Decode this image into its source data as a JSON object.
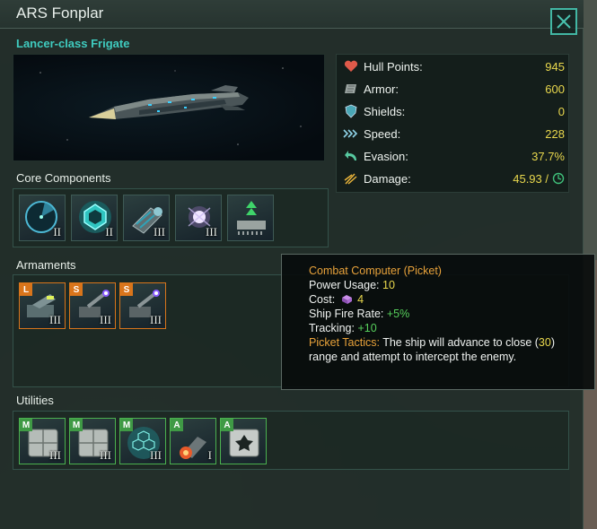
{
  "window": {
    "title": "ARS Fonplar",
    "ship_class": "Lancer-class Frigate"
  },
  "stats": [
    {
      "icon": "heart-icon",
      "label": "Hull Points:",
      "value": "945"
    },
    {
      "icon": "armor-plate-icon",
      "label": "Armor:",
      "value": "600"
    },
    {
      "icon": "shield-icon",
      "label": "Shields:",
      "value": "0"
    },
    {
      "icon": "speed-chevrons-icon",
      "label": "Speed:",
      "value": "228"
    },
    {
      "icon": "evasion-arrow-icon",
      "label": "Evasion:",
      "value": "37.7%"
    },
    {
      "icon": "damage-sparks-icon",
      "label": "Damage:",
      "value": "45.93 /"
    }
  ],
  "sections": {
    "core": "Core Components",
    "armaments": "Armaments",
    "utilities": "Utilities"
  },
  "core_components": [
    {
      "icon": "radar-sensor-icon",
      "tier": "II"
    },
    {
      "icon": "hyperdrive-icon",
      "tier": "II"
    },
    {
      "icon": "thruster-icon",
      "tier": "III"
    },
    {
      "icon": "reactor-icon",
      "tier": "III"
    },
    {
      "icon": "combat-computer-icon",
      "tier": ""
    }
  ],
  "armaments": [
    {
      "slot": "L",
      "icon": "missile-launcher-icon",
      "tier": "III"
    },
    {
      "slot": "S",
      "icon": "laser-turret-icon",
      "tier": "III"
    },
    {
      "slot": "S",
      "icon": "laser-turret-icon",
      "tier": "III"
    }
  ],
  "utilities": [
    {
      "slot": "M",
      "icon": "armor-plating-icon",
      "tier": "III"
    },
    {
      "slot": "M",
      "icon": "armor-plating-icon",
      "tier": "III"
    },
    {
      "slot": "M",
      "icon": "hex-shield-icon",
      "tier": "III"
    },
    {
      "slot": "A",
      "icon": "afterburner-icon",
      "tier": "I"
    },
    {
      "slot": "A",
      "icon": "auxiliary-module-icon",
      "tier": ""
    }
  ],
  "tooltip": {
    "title": "Combat Computer (Picket)",
    "power_label": "Power Usage:",
    "power_value": "10",
    "cost_label": "Cost:",
    "cost_value": "4",
    "fire_rate_label": "Ship Fire Rate:",
    "fire_rate_value": "+5%",
    "tracking_label": "Tracking:",
    "tracking_value": "+10",
    "tactics_label": "Picket Tactics:",
    "tactics_text_1": "The ship will advance to close (",
    "tactics_range": "30",
    "tactics_text_2": ") range and attempt to intercept the enemy."
  },
  "colors": {
    "accent_teal": "#3fcbbf",
    "value_yellow": "#e9d84d",
    "weapon_orange": "#d9751b",
    "utility_green": "#4bb14f"
  }
}
